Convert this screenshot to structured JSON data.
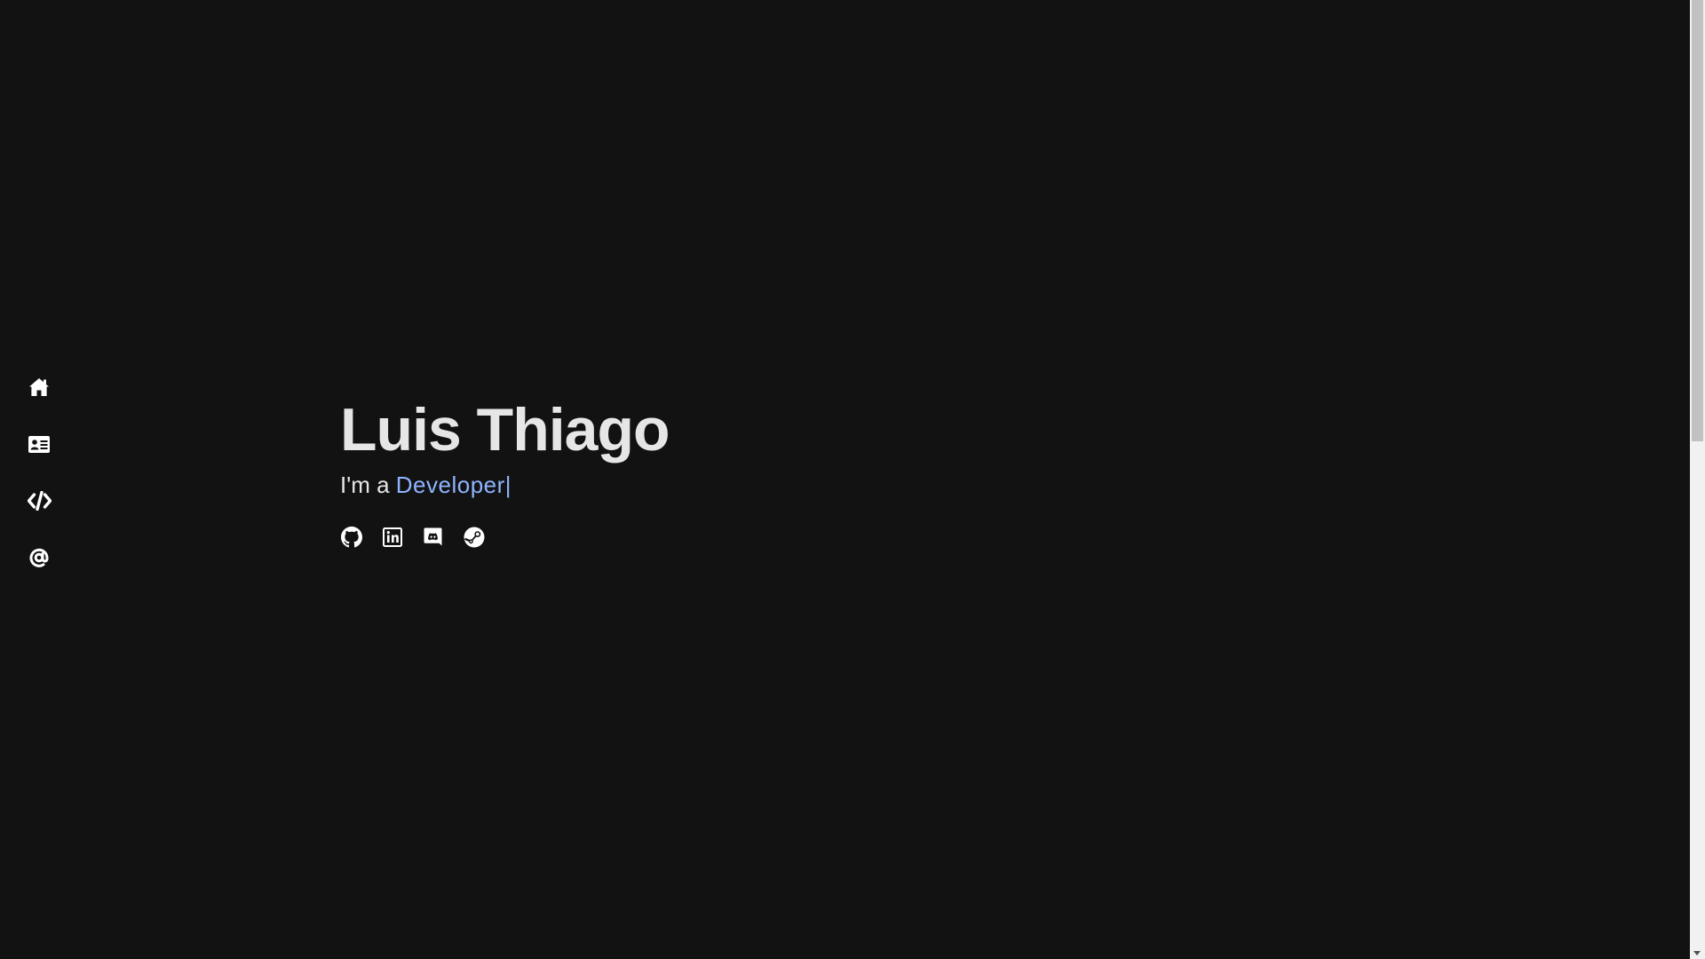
{
  "nav": {
    "items": [
      {
        "name": "home",
        "icon": "home-icon"
      },
      {
        "name": "about",
        "icon": "address-card-icon"
      },
      {
        "name": "projects",
        "icon": "code-icon"
      },
      {
        "name": "contact",
        "icon": "at-icon"
      }
    ]
  },
  "hero": {
    "name": "Luis Thiago",
    "prefix": "I'm a",
    "role": "Developer",
    "cursor": "|"
  },
  "social": [
    {
      "name": "github",
      "icon": "github-icon"
    },
    {
      "name": "linkedin",
      "icon": "linkedin-icon"
    },
    {
      "name": "discord",
      "icon": "discord-icon"
    },
    {
      "name": "steam",
      "icon": "steam-icon"
    }
  ],
  "colors": {
    "background": "#121212",
    "text": "#e6e6e6",
    "accent": "#8fb4ff",
    "icon": "#ffffff"
  }
}
